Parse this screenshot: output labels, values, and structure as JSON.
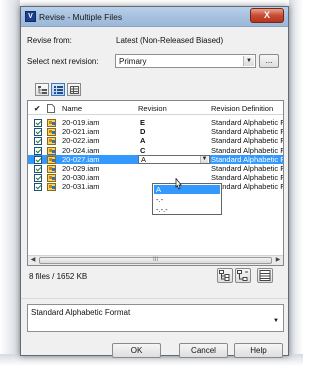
{
  "window": {
    "title": "Revise - Multiple Files",
    "close_label": "X"
  },
  "revise_from": {
    "label": "Revise from:",
    "value": "Latest (Non-Released Biased)"
  },
  "next_revision": {
    "label": "Select next revision:",
    "value": "Primary",
    "more_label": "..."
  },
  "toolbar": {
    "icons": [
      "tree-view-icon",
      "list-view-icon",
      "details-view-icon"
    ],
    "active": "list-view-icon"
  },
  "grid": {
    "columns": {
      "check": "✔",
      "icon": "",
      "name": "Name",
      "revision": "Revision",
      "definition": "Revision Definition"
    },
    "rows": [
      {
        "checked": true,
        "name": "20-019.iam",
        "revision": "E",
        "definition": "Standard Alphabetic F"
      },
      {
        "checked": true,
        "name": "20-021.iam",
        "revision": "D",
        "definition": "Standard Alphabetic F"
      },
      {
        "checked": true,
        "name": "20-022.iam",
        "revision": "A",
        "definition": "Standard Alphabetic F"
      },
      {
        "checked": true,
        "name": "20-024.iam",
        "revision": "C",
        "definition": "Standard Alphabetic F"
      },
      {
        "checked": true,
        "name": "20-027.iam",
        "revision": "A",
        "definition": "Standard Alphabetic F",
        "selected": true
      },
      {
        "checked": true,
        "name": "20-029.iam",
        "revision": "",
        "definition": "Standard Alphabetic F"
      },
      {
        "checked": true,
        "name": "20-030.iam",
        "revision": "",
        "definition": "Standard Alphabetic F"
      },
      {
        "checked": true,
        "name": "20-031.iam",
        "revision": "",
        "definition": "Standard Alphabetic F"
      }
    ],
    "revision_dropdown": {
      "options": [
        "A",
        "-.-",
        "-.-.-"
      ],
      "highlighted": "A"
    },
    "scroll_thumb_label": "III"
  },
  "status": {
    "files_text": "8 files / 1652 KB"
  },
  "bottom_toolbar": {
    "icons": [
      "expand-tree-icon",
      "collapse-tree-icon",
      "grid-settings-icon"
    ]
  },
  "description": {
    "value": "Standard Alphabetic Format"
  },
  "buttons": {
    "ok": "OK",
    "cancel": "Cancel",
    "help": "Help"
  }
}
